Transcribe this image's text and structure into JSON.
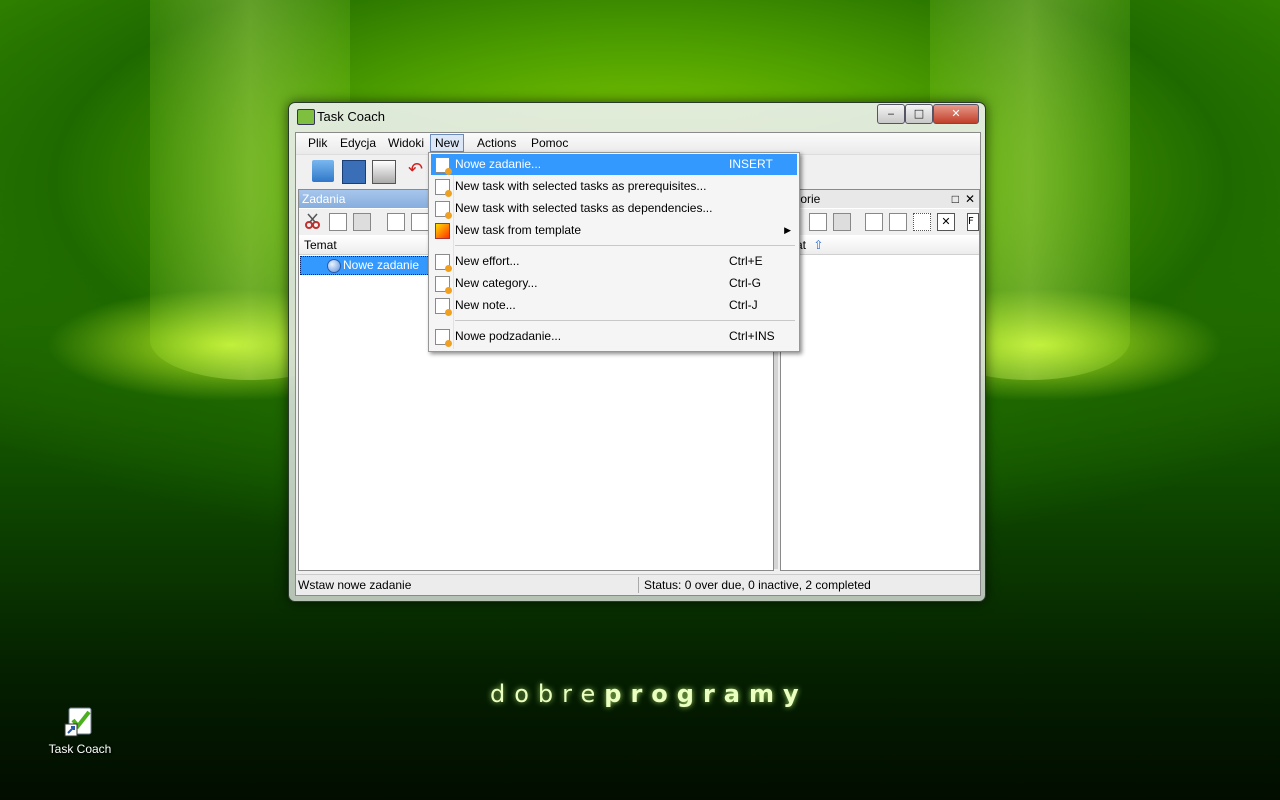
{
  "desktop": {
    "wordmark_light": "dobre",
    "wordmark_bold": "programy",
    "icon_label": "Task Coach"
  },
  "window": {
    "title": "Task Coach",
    "controls": {
      "minimize": "‒",
      "maximize": "□",
      "close": "✕"
    }
  },
  "menubar": {
    "items": [
      "Plik",
      "Edycja",
      "Widoki",
      "New",
      "Actions",
      "Pomoc"
    ],
    "open_item": "New"
  },
  "left_pane": {
    "title": "Zadania",
    "column_header": "Temat",
    "rows": [
      {
        "label": "Nowe zadanie",
        "selected": true
      }
    ]
  },
  "right_pane": {
    "title_visible": "egorie",
    "column_header_visible": "mat",
    "controls": {
      "maximize": "□",
      "close": "✕"
    },
    "partial_button": "F"
  },
  "statusbar": {
    "left": "Wstaw nowe zadanie",
    "right": "Status: 0 over due, 0 inactive, 2 completed"
  },
  "new_menu": {
    "group1": [
      {
        "label": "Nowe zadanie...",
        "shortcut": "INSERT",
        "highlighted": true
      },
      {
        "label": "New task with selected tasks as prerequisites...",
        "shortcut": ""
      },
      {
        "label": "New task with selected tasks as dependencies...",
        "shortcut": ""
      },
      {
        "label": "New task from template",
        "shortcut": "",
        "submenu_arrow": "▶"
      }
    ],
    "group2": [
      {
        "label": "New effort...",
        "shortcut": "Ctrl+E"
      },
      {
        "label": "New category...",
        "shortcut": "Ctrl-G"
      },
      {
        "label": "New note...",
        "shortcut": "Ctrl-J"
      }
    ],
    "group3": [
      {
        "label": "Nowe podzadanie...",
        "shortcut": "Ctrl+INS"
      }
    ]
  },
  "colors": {
    "selection": "#3399ff",
    "pane_header": "#99bbe8"
  }
}
